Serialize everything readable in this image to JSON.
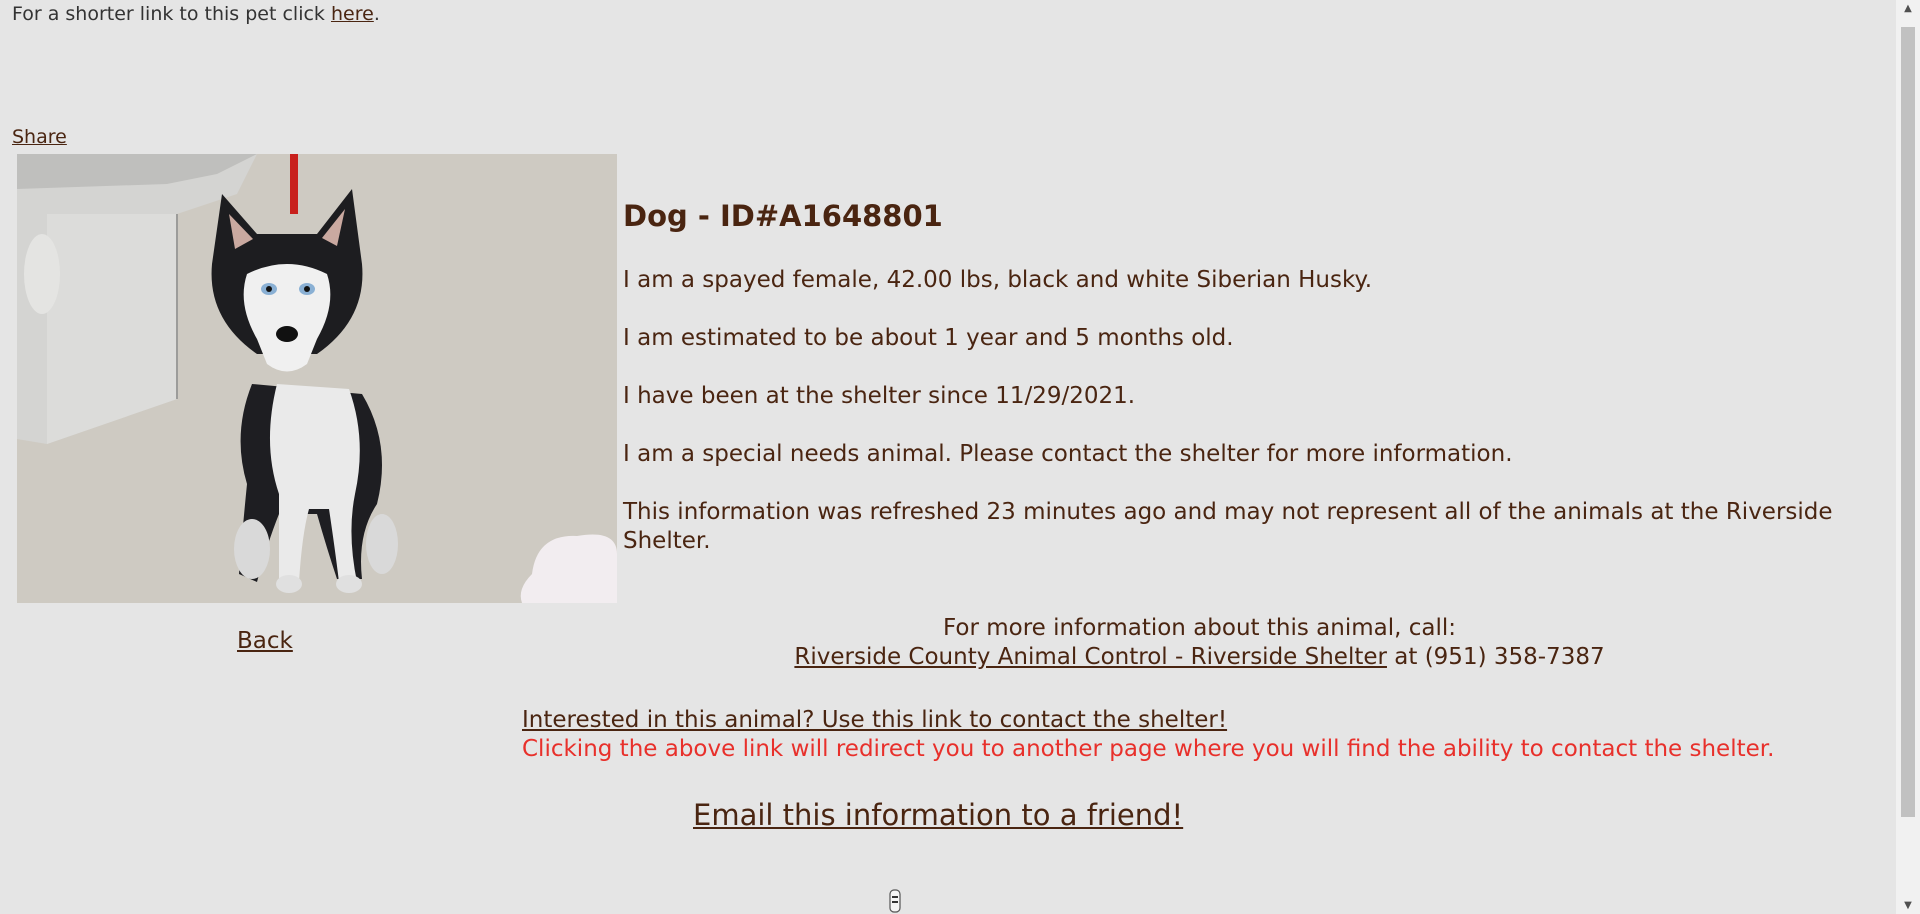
{
  "header": {
    "shortlink_prefix": "For a shorter link to this pet click",
    "shortlink_link": "here",
    "shortlink_suffix": ".",
    "share_label": "Share"
  },
  "animal": {
    "title": "Dog - ID#A1648801",
    "description": "I am a spayed female, 42.00 lbs, black and white Siberian Husky.",
    "age": "I am estimated to be about 1 year and 5 months old.",
    "since": "I have been at the shelter since 11/29/2021.",
    "special_needs": "I am a special needs animal. Please contact the shelter for more information.",
    "refresh_note": "This information was refreshed 23 minutes ago and may not represent all of the animals at the Riverside Shelter."
  },
  "nav": {
    "back_label": "Back"
  },
  "contact_info": {
    "call_prompt": "For more information about this animal, call:",
    "shelter_name": "Riverside County Animal Control - Riverside Shelter",
    "phone_text": "at (951) 358-7387",
    "interest_link": "Interested in this animal? Use this link to contact the shelter!",
    "redirect_note": "Clicking the above link will redirect you to another page where you will find the ability to contact the shelter.",
    "email_link": "Email this information to a friend!"
  },
  "icons": {
    "scroll_up": "chevron-up-icon",
    "scroll_down": "chevron-down-icon",
    "loading": "loading-spinner-icon"
  },
  "colors": {
    "background": "#e5e5e5",
    "text": "#4a2511",
    "warning": "#e8302b"
  }
}
